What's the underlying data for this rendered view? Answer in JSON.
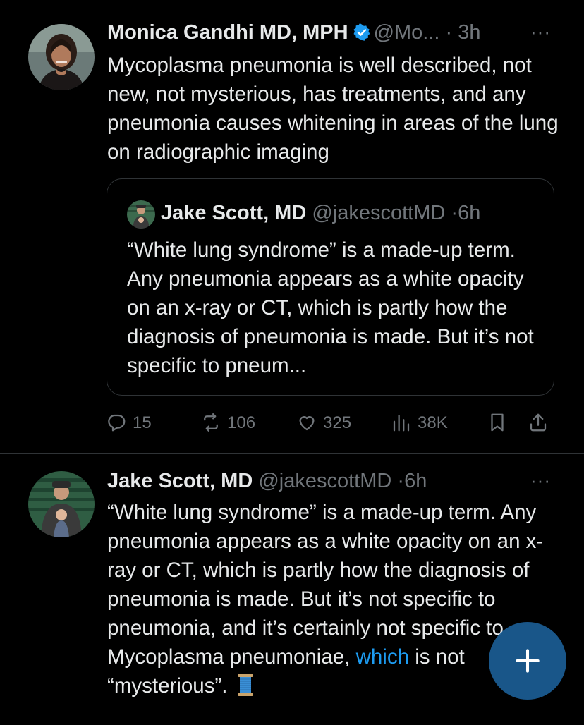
{
  "tweet1": {
    "name": "Monica Gandhi MD, MPH",
    "handle": "@Mo...",
    "dot": "·",
    "time": "3h",
    "more": "···",
    "text": "Mycoplasma pneumonia is well described, not new, not mysterious, has treatments, and any pneumonia causes whitening in areas of the lung on radiographic imaging",
    "quote": {
      "name": "Jake Scott, MD",
      "handle": "@jakescottMD",
      "dot": "·",
      "time": "6h",
      "text": "“White lung syndrome” is a made-up term. Any pneumonia appears as a white opacity on an x-ray or CT, which is partly how the diagnosis of pneumonia is made. But it’s not specific to pneum..."
    },
    "actions": {
      "replies": "15",
      "reposts": "106",
      "likes": "325",
      "views": "38K"
    }
  },
  "tweet2": {
    "name": "Jake Scott, MD",
    "handle": "@jakescottMD",
    "dot": "·",
    "time": "6h",
    "more": "···",
    "text_main": "“White lung syndrome” is a made-up term. Any pneumonia appears as a white opacity on an x-ray or CT, which is partly how the diagnosis of pneumonia is made. But it’s not specific to pneumonia, and it’s certainly not specific to Mycoplasma pneumoniae,",
    "text_link": "which",
    "text_end": "is not “mysterious”.",
    "emoji": "spool-of-thread"
  },
  "icons": {
    "verified": "verified-badge-icon",
    "reply": "reply-icon",
    "repost": "repost-icon",
    "like": "heart-icon",
    "views": "views-icon",
    "bookmark": "bookmark-icon",
    "share": "share-icon",
    "compose": "plus-icon"
  },
  "colors": {
    "background": "#000000",
    "text": "#e7e9ea",
    "secondary": "#71767b",
    "accent": "#1d9bf0",
    "border": "#2f3336"
  }
}
